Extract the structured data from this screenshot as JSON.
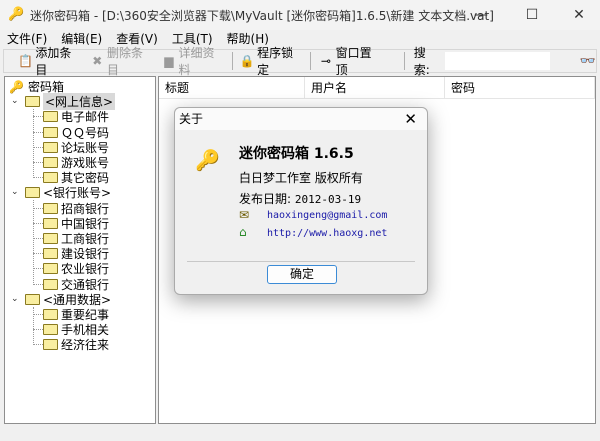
{
  "window": {
    "title": "迷你密码箱 - [D:\\360安全浏览器下载\\MyVault [迷你密码箱]1.6.5\\新建 文本文档.vat]",
    "minimize": "—",
    "maximize": "☐",
    "close": "✕"
  },
  "menu": [
    "文件(F)",
    "编辑(E)",
    "查看(V)",
    "工具(T)",
    "帮助(H)"
  ],
  "toolbar": {
    "add": "添加条目",
    "delete": "删除条目",
    "details": "详细资料",
    "lock": "程序锁定",
    "pin": "窗口置顶",
    "search_label": "搜索:",
    "search_value": ""
  },
  "tree": {
    "root": "密码箱",
    "groups": [
      {
        "label": "<网上信息>",
        "items": [
          "电子邮件",
          "ＱＱ号码",
          "论坛账号",
          "游戏账号",
          "其它密码"
        ]
      },
      {
        "label": "<银行账号>",
        "items": [
          "招商银行",
          "中国银行",
          "工商银行",
          "建设银行",
          "农业银行",
          "交通银行"
        ]
      },
      {
        "label": "<通用数据>",
        "items": [
          "重要纪事",
          "手机相关",
          "经济往来"
        ]
      }
    ]
  },
  "list": {
    "columns": [
      "标题",
      "用户名",
      "密码"
    ]
  },
  "about": {
    "title": "关于",
    "app": "迷你密码箱 1.6.5",
    "copyright": "白日梦工作室 版权所有",
    "date_label": "发布日期:",
    "date": "2012-03-19",
    "email": "haoxingeng@gmail.com",
    "url": "http://www.haoxg.net",
    "ok": "确定"
  }
}
